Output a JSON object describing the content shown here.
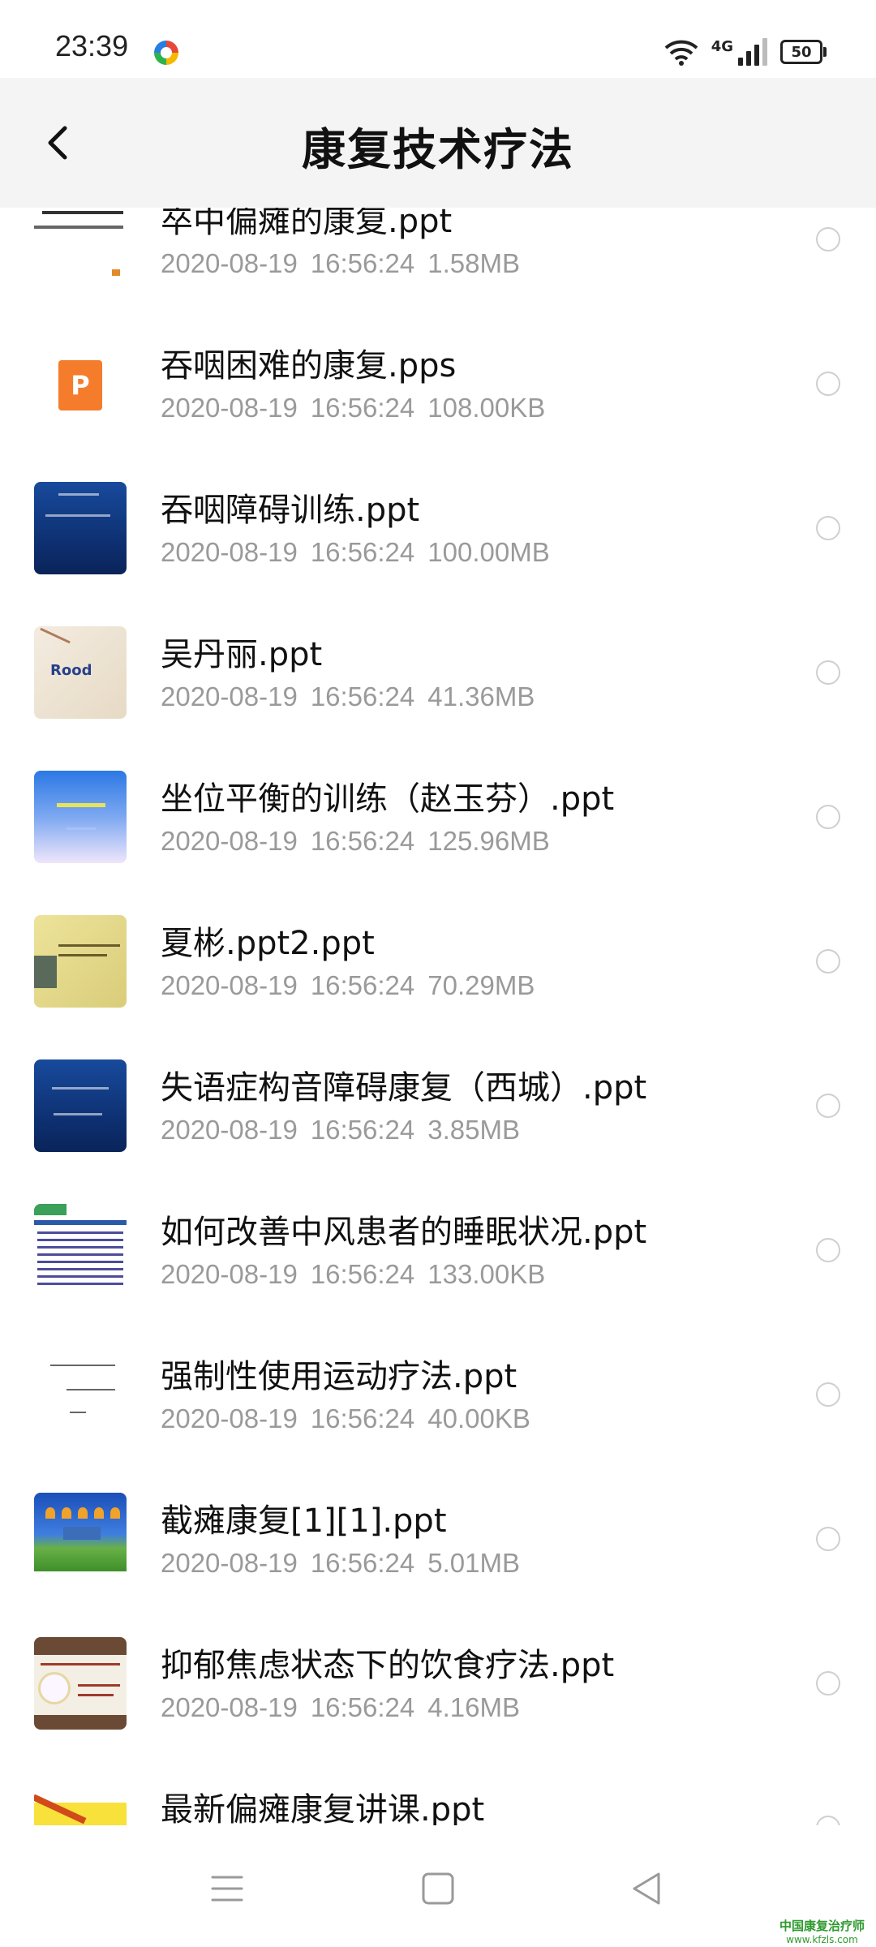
{
  "status_bar": {
    "time": "23:39",
    "network_label": "4G",
    "battery": "50",
    "icons": [
      "app-notification-icon",
      "wifi-icon",
      "cellular-signal-icon",
      "battery-icon"
    ]
  },
  "header": {
    "title": "康复技术疗法",
    "back_icon": "chevron-left-icon"
  },
  "files": [
    {
      "name": "卒中偏瘫的康复.ppt",
      "date": "2020-08-19",
      "time": "16:56:24",
      "size": "1.58MB",
      "thumbnail": "document-white"
    },
    {
      "name": "吞咽困难的康复.pps",
      "date": "2020-08-19",
      "time": "16:56:24",
      "size": "108.00KB",
      "thumbnail": "presentation-file-icon"
    },
    {
      "name": "吞咽障碍训练.ppt",
      "date": "2020-08-19",
      "time": "16:56:24",
      "size": "100.00MB",
      "thumbnail": "blue-slide"
    },
    {
      "name": "吴丹丽.ppt",
      "date": "2020-08-19",
      "time": "16:56:24",
      "size": "41.36MB",
      "thumbnail": "rood-slide"
    },
    {
      "name": "坐位平衡的训练（赵玉芬）.ppt",
      "date": "2020-08-19",
      "time": "16:56:24",
      "size": "125.96MB",
      "thumbnail": "sky-slide"
    },
    {
      "name": "夏彬.ppt2.ppt",
      "date": "2020-08-19",
      "time": "16:56:24",
      "size": "70.29MB",
      "thumbnail": "yellow-slide"
    },
    {
      "name": "失语症构音障碍康复（西城）.ppt",
      "date": "2020-08-19",
      "time": "16:56:24",
      "size": "3.85MB",
      "thumbnail": "blue-slide"
    },
    {
      "name": "如何改善中风患者的睡眠状况.ppt",
      "date": "2020-08-19",
      "time": "16:56:24",
      "size": "133.00KB",
      "thumbnail": "text-slide"
    },
    {
      "name": "强制性使用运动疗法.ppt",
      "date": "2020-08-19",
      "time": "16:56:24",
      "size": "40.00KB",
      "thumbnail": "plain-slide"
    },
    {
      "name": "截瘫康复[1][1].ppt",
      "date": "2020-08-19",
      "time": "16:56:24",
      "size": "5.01MB",
      "thumbnail": "field-slide"
    },
    {
      "name": "抑郁焦虑状态下的饮食疗法.ppt",
      "date": "2020-08-19",
      "time": "16:56:24",
      "size": "4.16MB",
      "thumbnail": "flower-slide"
    },
    {
      "name": "最新偏瘫康复讲课.ppt",
      "date": "",
      "time": "",
      "size": "",
      "thumbnail": "yellow-pen-slide"
    }
  ],
  "nav_bar": {
    "buttons": [
      "menu-icon",
      "home-square-icon",
      "back-triangle-icon"
    ]
  },
  "watermark": {
    "line1": "中国康复治疗师",
    "line2": "www.kfzls.com"
  }
}
